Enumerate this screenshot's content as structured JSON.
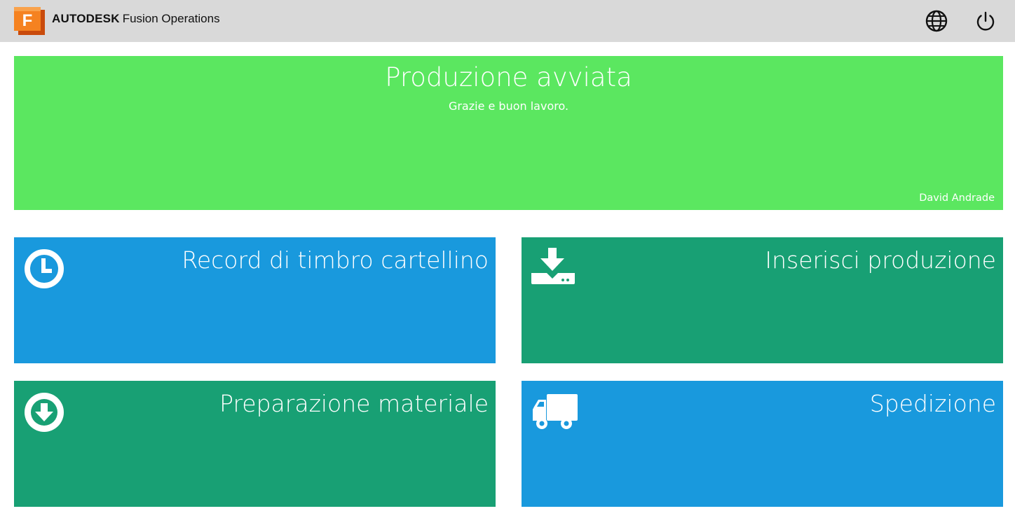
{
  "header": {
    "brand_bold": "AUTODESK",
    "brand_product": "Fusion Operations",
    "logo_letter": "F",
    "icons": [
      "logo-icon",
      "globe-icon",
      "power-icon"
    ]
  },
  "banner": {
    "title": "Produzione avviata",
    "subtitle": "Grazie e buon lavoro.",
    "user": "David Andrade",
    "color": "#5be760"
  },
  "tiles": [
    {
      "label": "Record di timbro cartellino",
      "icon": "clock-icon",
      "color": "#1999dd"
    },
    {
      "label": "Inserisci produzione",
      "icon": "download-tray-icon",
      "color": "#18a074"
    },
    {
      "label": "Preparazione materiale",
      "icon": "arrow-down-circle-icon",
      "color": "#18a074"
    },
    {
      "label": "Spedizione",
      "icon": "truck-icon",
      "color": "#1999dd"
    }
  ]
}
